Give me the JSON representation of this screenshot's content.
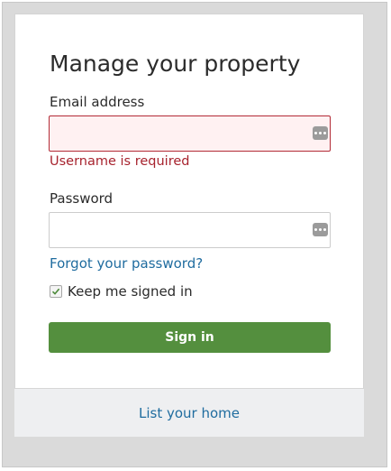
{
  "form": {
    "title": "Manage your property",
    "email": {
      "label": "Email address",
      "value": "",
      "error": "Username is required",
      "icon": "password-manager-icon"
    },
    "password": {
      "label": "Password",
      "value": "",
      "icon": "password-manager-icon"
    },
    "forgot_link": "Forgot your password?",
    "remember": {
      "label": "Keep me signed in",
      "checked": true
    },
    "submit_label": "Sign in"
  },
  "footer": {
    "link": "List your home"
  },
  "colors": {
    "primary_button": "#548f3e",
    "link": "#1f6c9f",
    "error": "#a7232e",
    "error_field_bg": "#fff1f2"
  }
}
